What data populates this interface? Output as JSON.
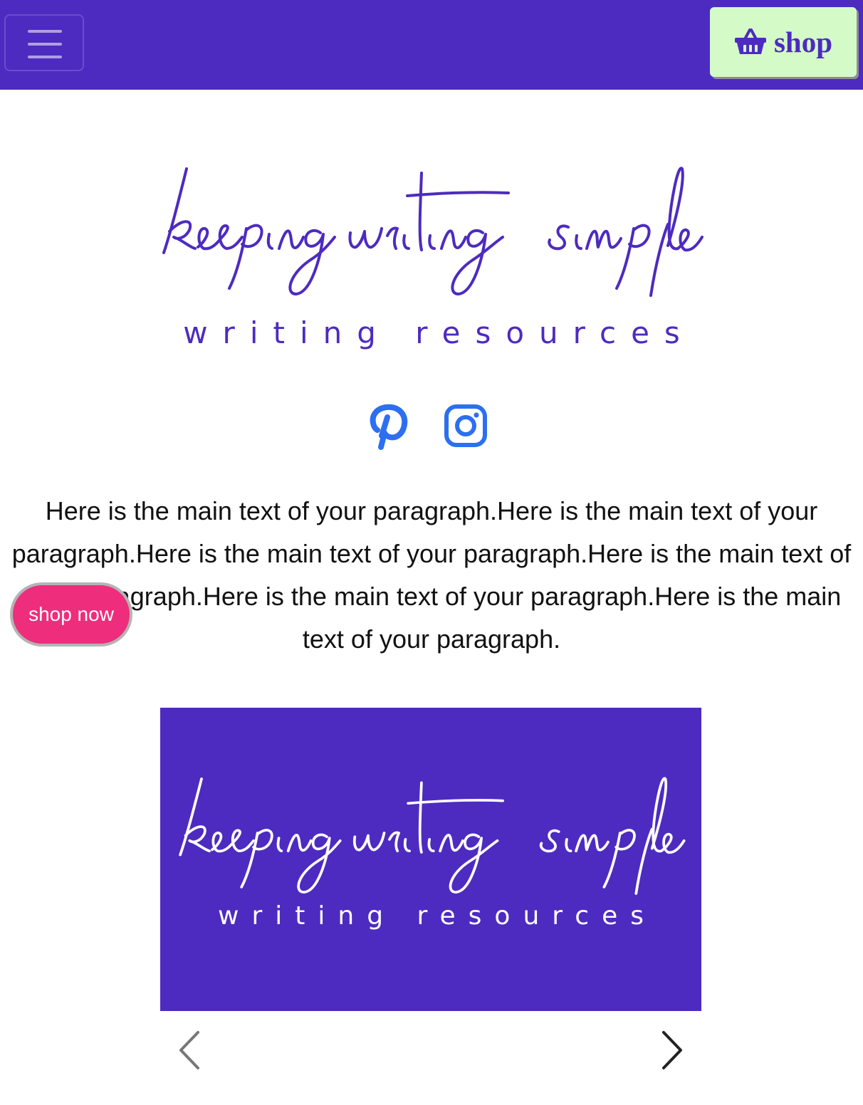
{
  "header": {
    "menu_icon": "hamburger-menu-icon",
    "shop_label": "shop",
    "shop_icon": "shopping-basket-icon",
    "bg_color": "#4d2bc0",
    "shop_bg_color": "#d4fac8"
  },
  "brand": {
    "script_title": "keeping writing simple",
    "subtitle": "writing resources",
    "color": "#4d2bc0"
  },
  "social": [
    {
      "name": "pinterest",
      "icon": "pinterest-icon"
    },
    {
      "name": "instagram",
      "icon": "instagram-icon"
    }
  ],
  "main": {
    "paragraph": "Here is the main text of your paragraph.Here is the main text of your paragraph.Here is the main text of your paragraph.Here is the main text of your paragraph.Here is the main text of your paragraph.Here is the main text of your paragraph."
  },
  "cta": {
    "label": "shop now",
    "color": "#ee2d7d"
  },
  "carousel": {
    "slide_title": "keeping writing simple",
    "slide_subtitle": "writing resources",
    "slide_bg": "#4d2bc0",
    "prev_icon": "chevron-left-icon",
    "next_icon": "chevron-right-icon"
  }
}
